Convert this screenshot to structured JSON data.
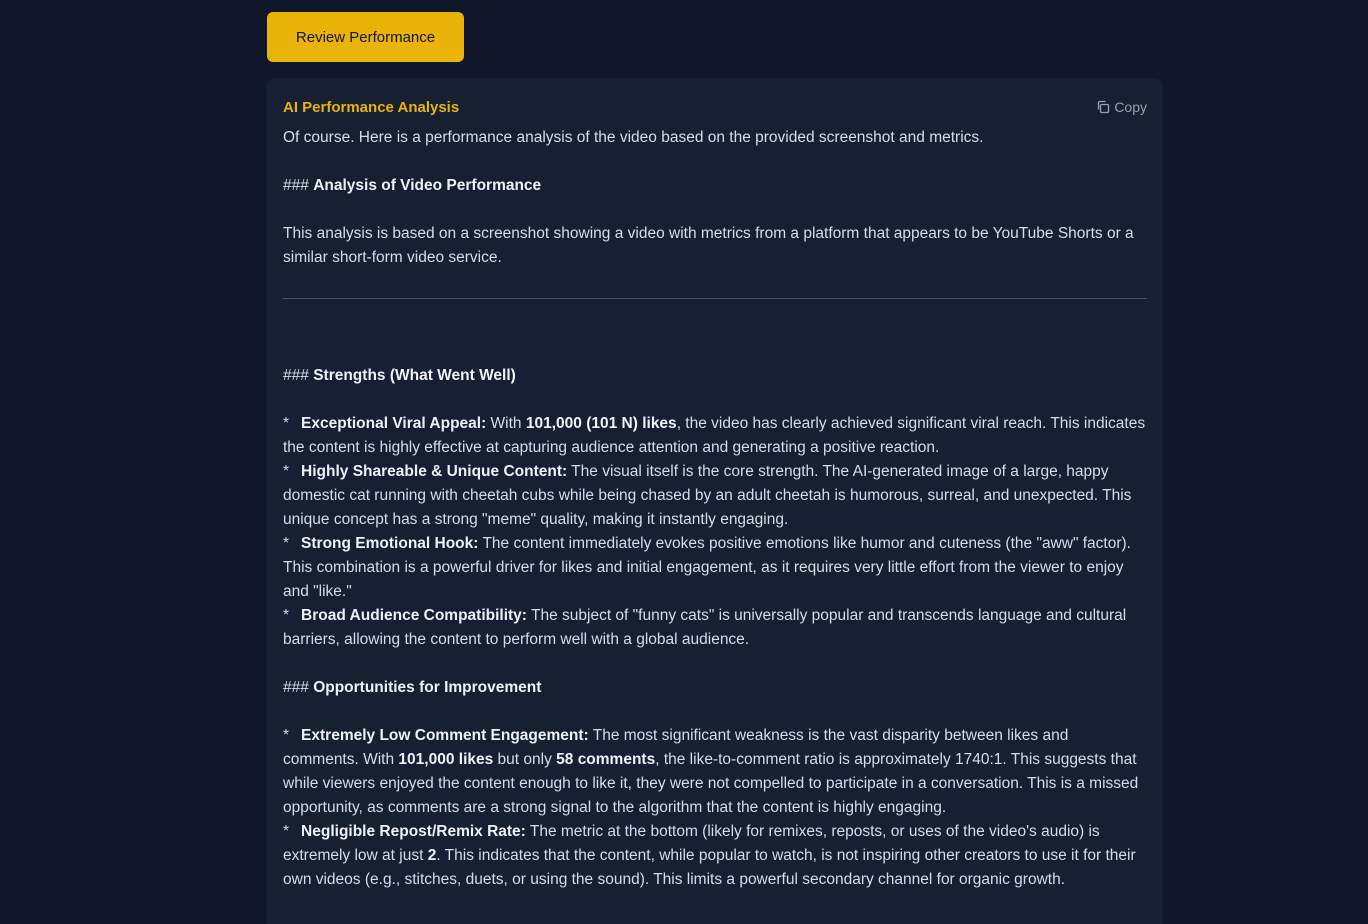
{
  "review_button": {
    "label": "Review Performance"
  },
  "panel": {
    "title": "AI Performance Analysis",
    "copy_label": "Copy"
  },
  "analysis": {
    "intro": "Of course. Here is a performance analysis of the video based on the provided screenshot and metrics.",
    "heading_prefix": "###",
    "heading1": "Analysis of Video Performance",
    "para1": "This analysis is based on a screenshot showing a video with metrics from a platform that appears to be YouTube Shorts or a similar short-form video service.",
    "heading2": "Strengths (What Went Well)",
    "bullet_star": "*",
    "strengths": [
      {
        "title": "Exceptional Viral Appeal:",
        "pre": " With ",
        "bold": "101,000 (101 N) likes",
        "post": ", the video has clearly achieved significant viral reach. This indicates the content is highly effective at capturing audience attention and generating a positive reaction."
      },
      {
        "title": "Highly Shareable & Unique Content:",
        "text": " The visual itself is the core strength. The AI-generated image of a large, happy domestic cat running with cheetah cubs while being chased by an adult cheetah is humorous, surreal, and unexpected. This unique concept has a strong \"meme\" quality, making it instantly engaging."
      },
      {
        "title": "Strong Emotional Hook:",
        "text": " The content immediately evokes positive emotions like humor and cuteness (the \"aww\" factor). This combination is a powerful driver for likes and initial engagement, as it requires very little effort from the viewer to enjoy and \"like.\""
      },
      {
        "title": "Broad Audience Compatibility:",
        "text": " The subject of \"funny cats\" is universally popular and transcends language and cultural barriers, allowing the content to perform well with a global audience."
      }
    ],
    "heading3": "Opportunities for Improvement",
    "improvements": [
      {
        "title": "Extremely Low Comment Engagement:",
        "pre": " The most significant weakness is the vast disparity between likes and comments. With ",
        "bold1": "101,000 likes",
        "mid": " but only ",
        "bold2": "58 comments",
        "post": ", the like-to-comment ratio is approximately 1740:1. This suggests that while viewers enjoyed the content enough to like it, they were not compelled to participate in a conversation. This is a missed opportunity, as comments are a strong signal to the algorithm that the content is highly engaging."
      },
      {
        "title": "Negligible Repost/Remix Rate:",
        "pre": " The metric at the bottom (likely for remixes, reposts, or uses of the video's audio) is extremely low at just ",
        "bold": "2",
        "post": ". This indicates that the content, while popular to watch, is not inspiring other creators to use it for their own videos (e.g., stitches, duets, or using the sound). This limits a powerful secondary channel for organic growth."
      }
    ]
  },
  "colors": {
    "background": "#0f1729",
    "panel": "#172033",
    "accent": "#eab308",
    "text": "#d6dce6",
    "muted": "#94a3b8"
  }
}
